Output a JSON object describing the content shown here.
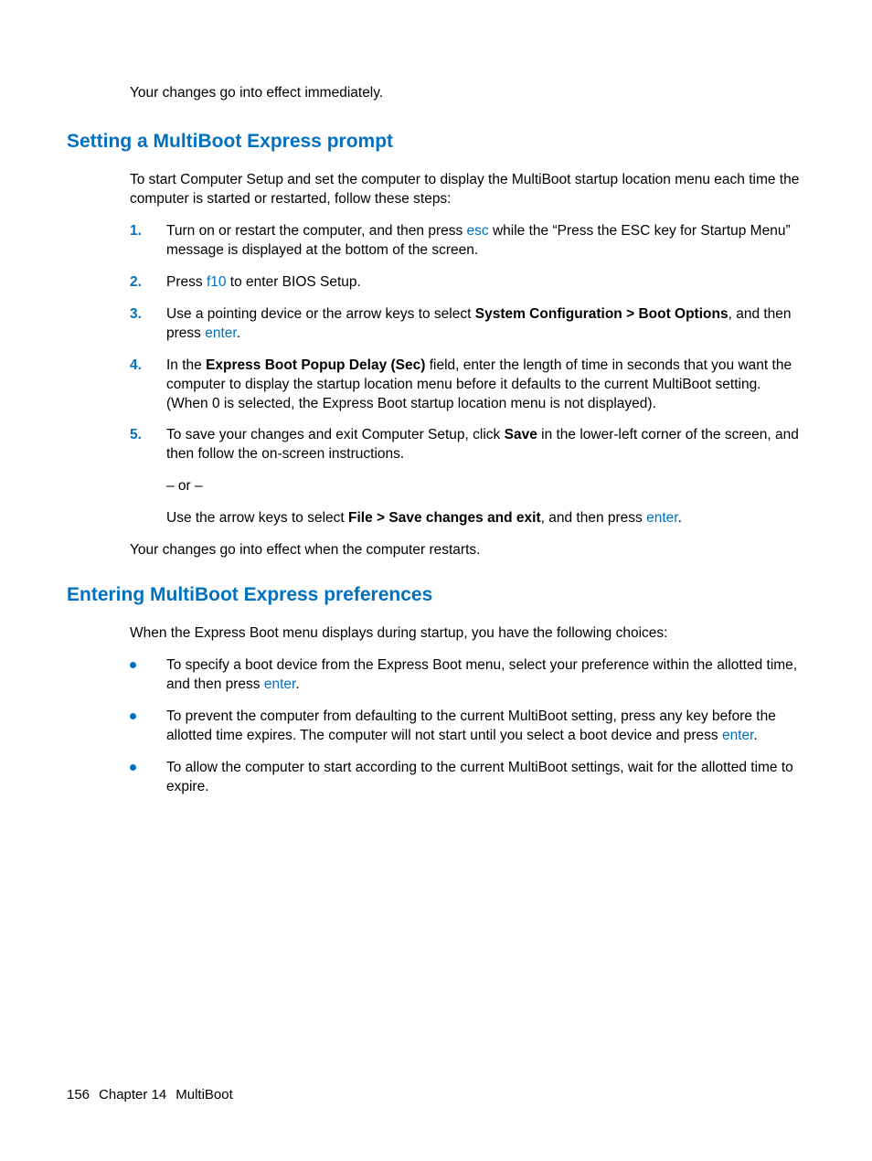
{
  "intro": "Your changes go into effect immediately.",
  "section1": {
    "heading": "Setting a MultiBoot Express prompt",
    "lead": "To start Computer Setup and set the computer to display the MultiBoot startup location menu each time the computer is started or restarted, follow these steps:",
    "steps": {
      "s1_a": "Turn on or restart the computer, and then press ",
      "s1_key": "esc",
      "s1_b": " while the “Press the ESC key for Startup Menu” message is displayed at the bottom of the screen.",
      "s2_a": "Press ",
      "s2_key": "f10",
      "s2_b": " to enter BIOS Setup.",
      "s3_a": "Use a pointing device or the arrow keys to select ",
      "s3_bold": "System Configuration > Boot Options",
      "s3_b": ", and then press ",
      "s3_key": "enter",
      "s3_c": ".",
      "s4_a": "In the ",
      "s4_bold": "Express Boot Popup Delay (Sec)",
      "s4_b": " field, enter the length of time in seconds that you want the computer to display the startup location menu before it defaults to the current MultiBoot setting. (When 0 is selected, the Express Boot startup location menu is not displayed).",
      "s5_a": "To save your changes and exit Computer Setup, click ",
      "s5_bold": "Save",
      "s5_b": " in the lower-left corner of the screen, and then follow the on-screen instructions.",
      "s5_or": "– or –",
      "s5_c": "Use the arrow keys to select ",
      "s5_bold2": "File > Save changes and exit",
      "s5_d": ", and then press ",
      "s5_key": "enter",
      "s5_e": "."
    },
    "tail": "Your changes go into effect when the computer restarts."
  },
  "section2": {
    "heading": "Entering MultiBoot Express preferences",
    "lead": "When the Express Boot menu displays during startup, you have the following choices:",
    "bullets": {
      "b1_a": "To specify a boot device from the Express Boot menu, select your preference within the allotted time, and then press ",
      "b1_key": "enter",
      "b1_b": ".",
      "b2_a": "To prevent the computer from defaulting to the current MultiBoot setting, press any key before the allotted time expires. The computer will not start until you select a boot device and press ",
      "b2_key": "enter",
      "b2_b": ".",
      "b3": "To allow the computer to start according to the current MultiBoot settings, wait for the allotted time to expire."
    }
  },
  "footer": {
    "page": "156",
    "chapter": "Chapter 14",
    "title": "MultiBoot"
  },
  "labels": {
    "n1": "1.",
    "n2": "2.",
    "n3": "3.",
    "n4": "4.",
    "n5": "5."
  }
}
